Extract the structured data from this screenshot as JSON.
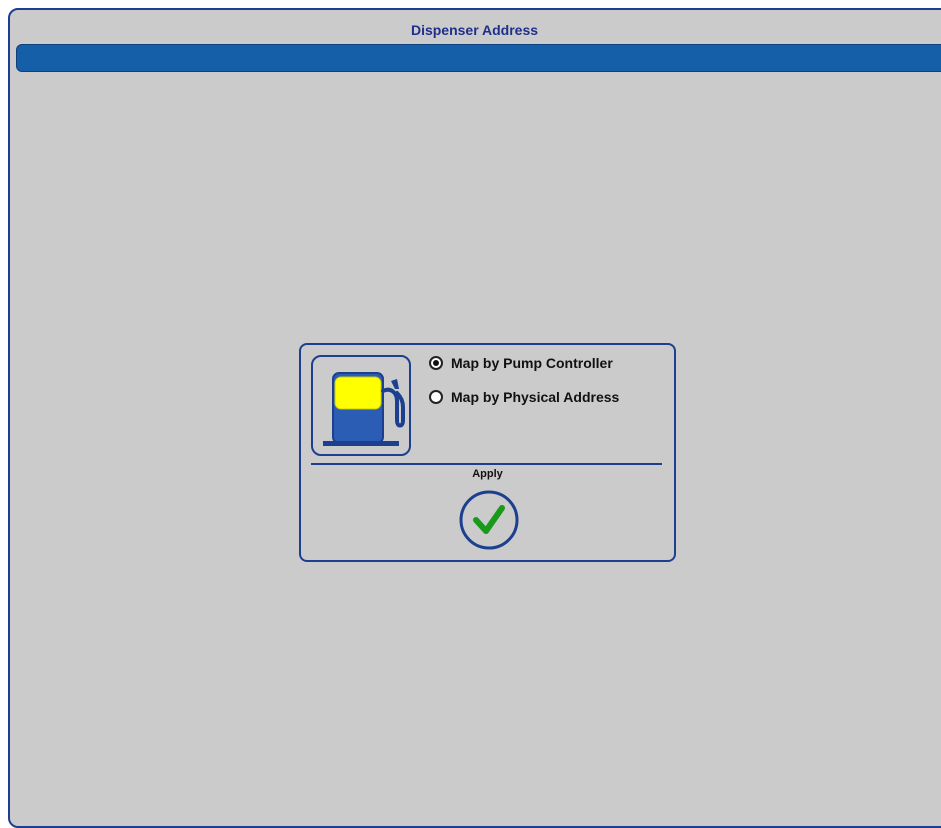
{
  "window": {
    "title": "Dispenser Address"
  },
  "panel": {
    "pump_icon": "fuel-pump-icon",
    "options": [
      {
        "label": "Map by Pump Controller",
        "selected": true
      },
      {
        "label": "Map by Physical Address",
        "selected": false
      }
    ],
    "apply_label": "Apply",
    "apply_icon": "checkmark-icon"
  },
  "colors": {
    "frame_border": "#1c3f8f",
    "title_text": "#1f2f8c",
    "title_bar": "#145fa8",
    "background": "#cbcbcb",
    "pump_screen": "#ffff00",
    "pump_body": "#2b5db5",
    "check_green": "#1a9a1a"
  }
}
